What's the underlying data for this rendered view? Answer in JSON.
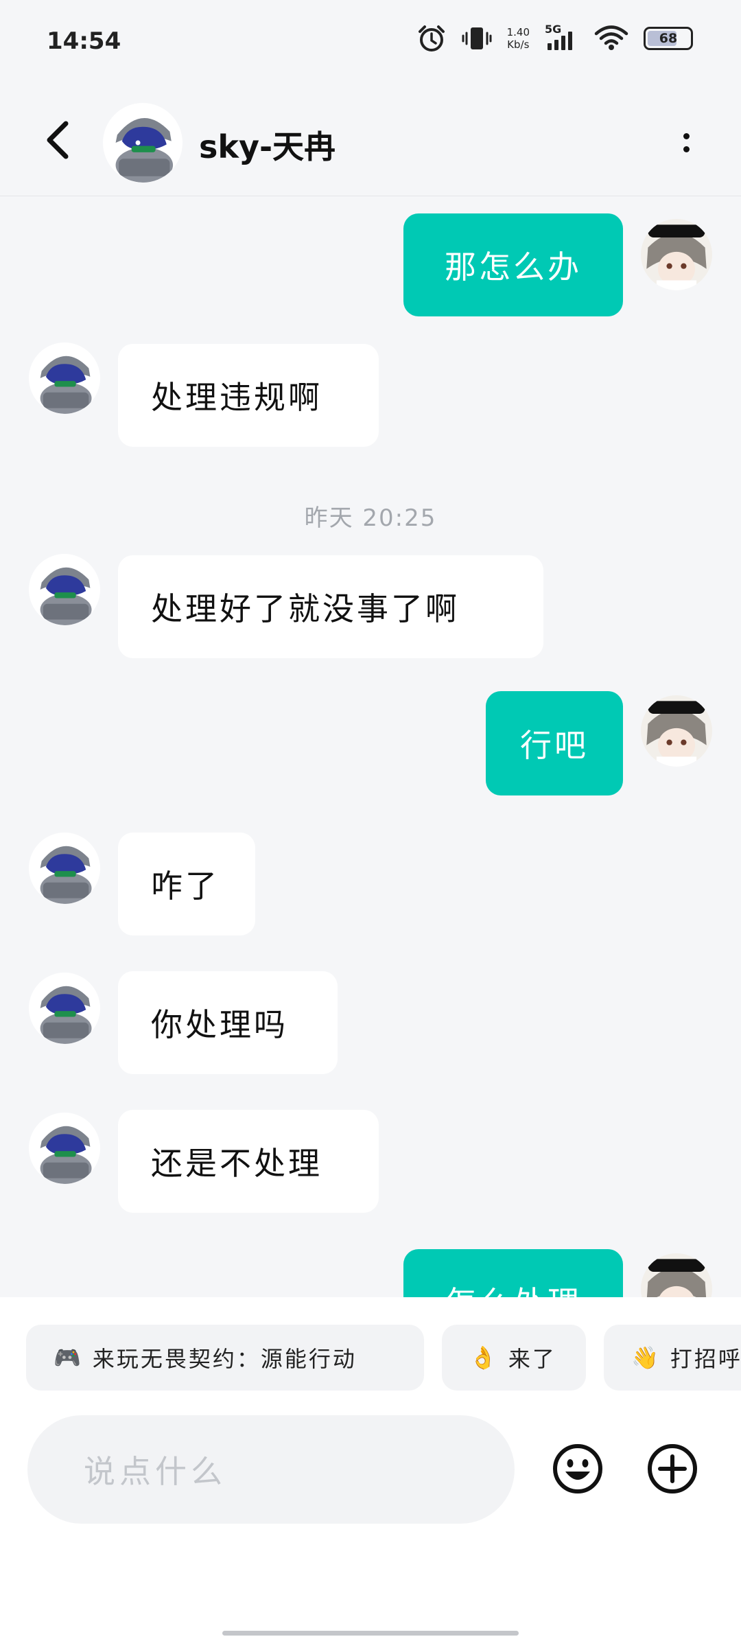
{
  "status_bar": {
    "time": "14:54",
    "net_speed_value": "1.40",
    "net_speed_unit": "Kb/s",
    "network": "5G",
    "battery": "68"
  },
  "header": {
    "title": "sky-天冉"
  },
  "messages": [
    {
      "side": "out",
      "text": "那怎么办"
    },
    {
      "side": "in",
      "text": "处理违规啊"
    },
    {
      "side": "in",
      "text": "处理好了就没事了啊"
    },
    {
      "side": "out",
      "text": "行吧"
    },
    {
      "side": "in",
      "text": "咋了"
    },
    {
      "side": "in",
      "text": "你处理吗"
    },
    {
      "side": "in",
      "text": "还是不处理"
    },
    {
      "side": "out",
      "text": "怎么处理"
    }
  ],
  "timestamp": "昨天  20:25",
  "quick_replies": [
    {
      "icon": "gamepad-icon",
      "emoji": "🎮",
      "text": "来玩无畏契约：源能行动"
    },
    {
      "icon": "ok-hand-icon",
      "emoji": "👌",
      "text": "来了"
    },
    {
      "icon": "wave-icon",
      "emoji": "👋",
      "text": "打招呼"
    }
  ],
  "input": {
    "placeholder": "说点什么"
  },
  "colors": {
    "outgoing_bubble": "#00c9b4",
    "incoming_bubble": "#ffffff",
    "background": "#f5f6f8"
  }
}
